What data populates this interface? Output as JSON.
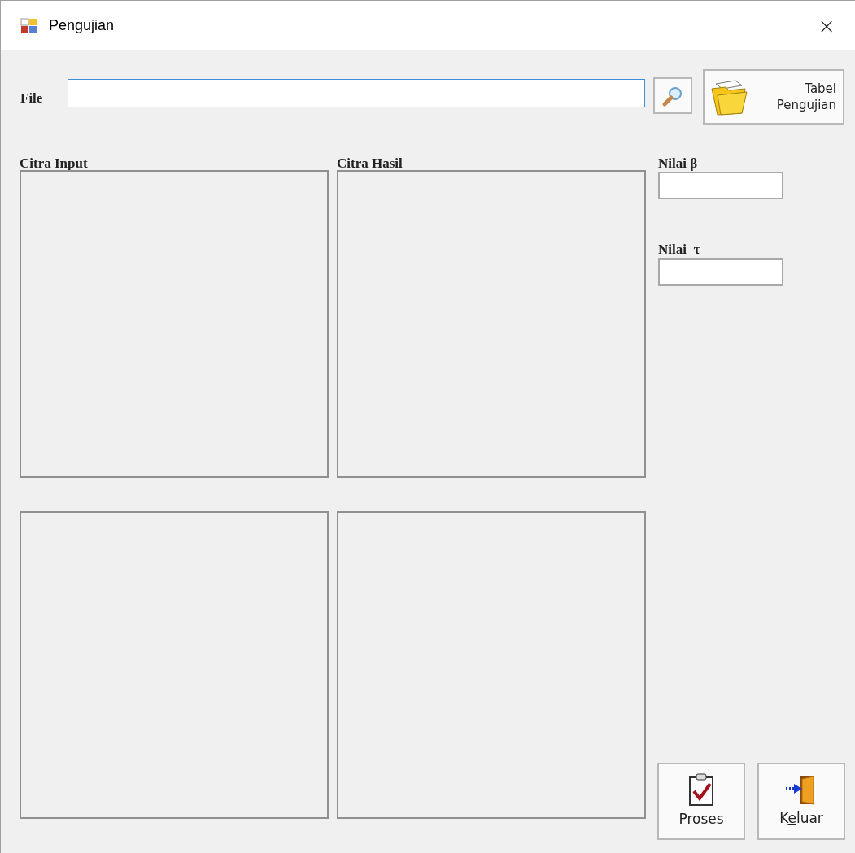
{
  "window": {
    "title": "Pengujian",
    "close": "×"
  },
  "file": {
    "label": "File"
  },
  "buttons_top": [
    {
      "kind": "search"
    },
    {
      "kind": "folder",
      "label": "Tabel Pengujian"
    }
  ],
  "panels": [
    {
      "label": "Citra Input"
    },
    {
      "label": "Citra Hasil"
    }
  ],
  "parameters": [
    {
      "label": "Nilai β"
    },
    {
      "label": "Nilai  τ"
    }
  ],
  "buttons_bottom": [
    {
      "kind": "process",
      "underlined": "P",
      "after": "roses"
    },
    {
      "kind": "exit",
      "before": "K",
      "underlined": "e",
      "after": "luar"
    }
  ]
}
